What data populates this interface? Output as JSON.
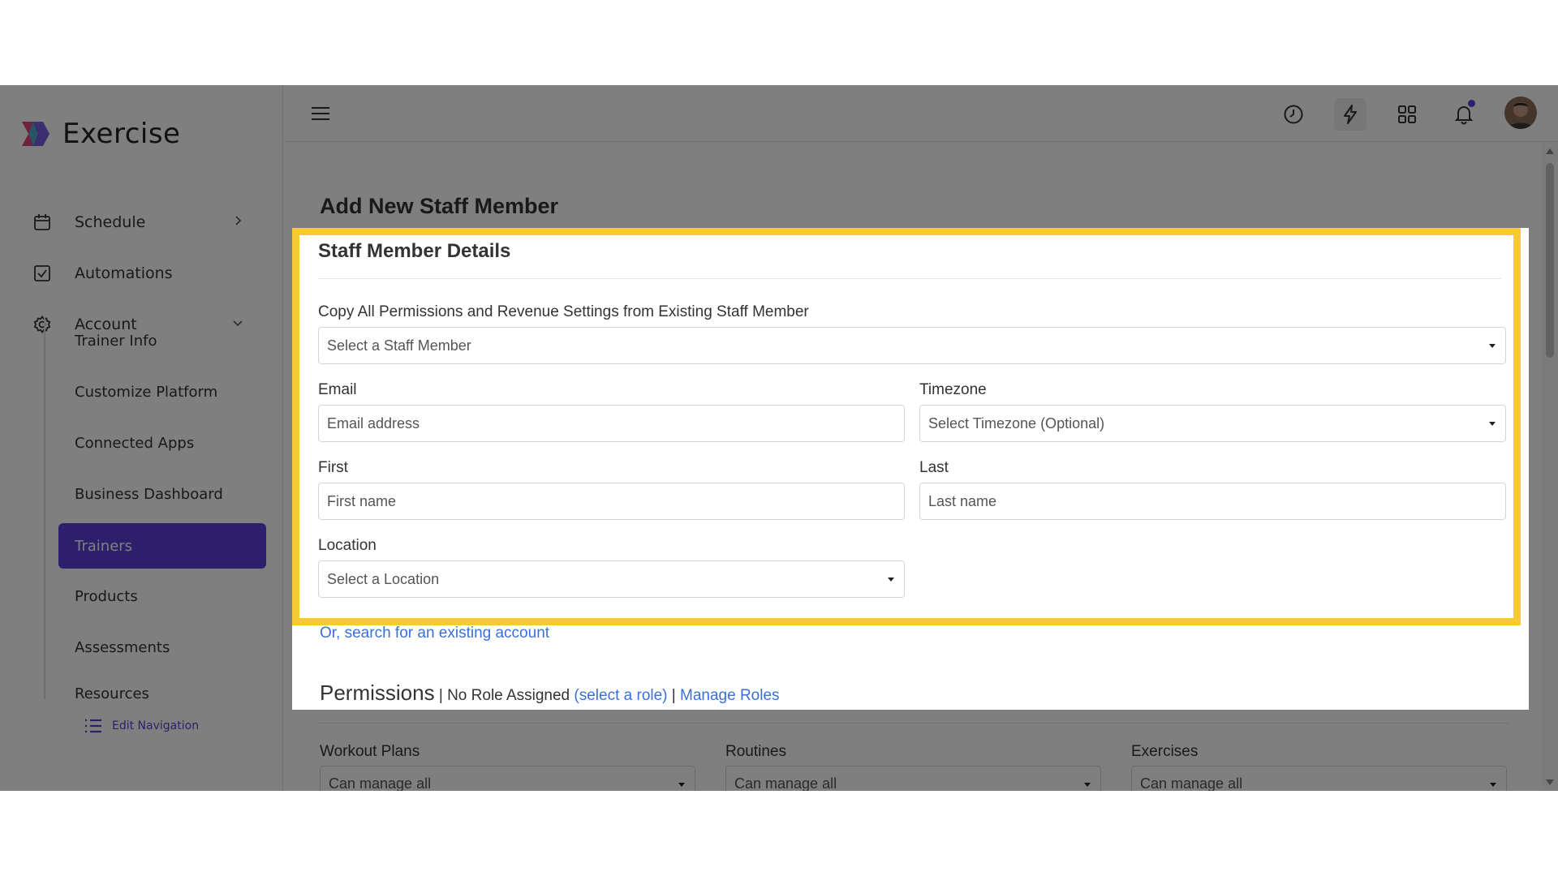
{
  "app": {
    "name": "Exercise"
  },
  "sidebar": {
    "items": [
      {
        "label": "Schedule",
        "icon": "calendar-icon",
        "chevron": "right"
      },
      {
        "label": "Automations",
        "icon": "checkbox-icon"
      },
      {
        "label": "Account",
        "icon": "gear-icon",
        "chevron": "down"
      }
    ],
    "subitems": [
      {
        "label": "Trainer Info"
      },
      {
        "label": "Customize Platform"
      },
      {
        "label": "Connected Apps"
      },
      {
        "label": "Business Dashboard"
      },
      {
        "label": "Trainers",
        "active": true
      },
      {
        "label": "Products"
      },
      {
        "label": "Assessments"
      },
      {
        "label": "Resources"
      }
    ],
    "edit_navigation": "Edit Navigation"
  },
  "header": {
    "icons": [
      "menu-icon",
      "clock-icon",
      "lightning-icon",
      "grid-icon",
      "bell-icon",
      "avatar"
    ]
  },
  "page": {
    "title": "Add New Staff Member",
    "details": {
      "title": "Staff Member Details",
      "copy_label": "Copy All Permissions and Revenue Settings from Existing Staff Member",
      "copy_placeholder": "Select a Staff Member",
      "email_label": "Email",
      "email_placeholder": "Email address",
      "timezone_label": "Timezone",
      "timezone_placeholder": "Select Timezone (Optional)",
      "first_label": "First",
      "first_placeholder": "First name",
      "last_label": "Last",
      "last_placeholder": "Last name",
      "location_label": "Location",
      "location_placeholder": "Select a Location"
    },
    "search_existing": "Or, search for an existing account",
    "permissions": {
      "title": "Permissions",
      "sep1": " | No Role Assigned ",
      "select_role": "(select a role)",
      "sep2": " | ",
      "manage_roles": "Manage Roles",
      "groups": [
        {
          "label": "Workout Plans",
          "value": "Can manage all"
        },
        {
          "label": "Routines",
          "value": "Can manage all"
        },
        {
          "label": "Exercises",
          "value": "Can manage all"
        }
      ]
    }
  },
  "colors": {
    "accent": "#5b3fd6",
    "highlight": "#f5ca32",
    "link": "#3b6fd8"
  }
}
